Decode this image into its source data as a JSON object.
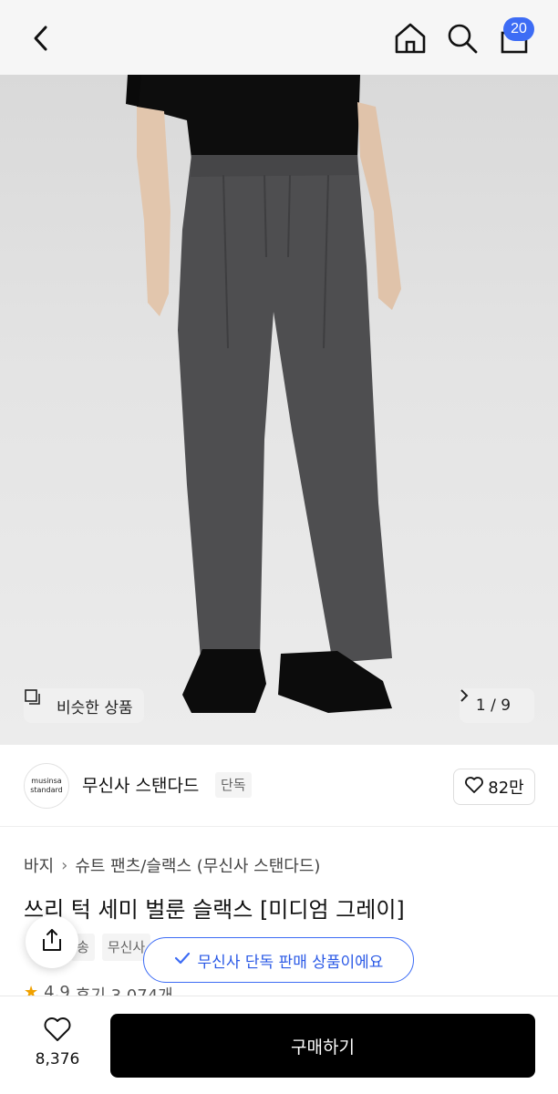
{
  "header": {
    "back_icon": "chevron-left-icon",
    "home_icon": "home-icon",
    "search_icon": "search-icon",
    "cart_icon": "shopping-bag-icon",
    "cart_count": "20",
    "badge_color": "#3d6cf5"
  },
  "gallery": {
    "similar_label": "비슷한 상품",
    "page_indicator": "1 / 9"
  },
  "brand": {
    "logo_line1": "musinsa",
    "logo_line2": "standard",
    "name": "무신사 스탠다드",
    "tag": "단독",
    "like_count": "82만"
  },
  "product": {
    "breadcrumb": [
      "바지",
      "슈트 팬츠/슬랙스 (무신사 스탠다드)"
    ],
    "title": "쓰리 턱 세미 벌룬 슬랙스 [미디엄 그레이]",
    "tags": [
      "송",
      "무신사"
    ],
    "rating": "4.9",
    "reviews": "후기 3,074개"
  },
  "toast": {
    "text": "무신사 단독 판매 상품이에요",
    "color": "#3d6cf5"
  },
  "bottom": {
    "wish_count": "8,376",
    "buy_label": "구매하기"
  }
}
